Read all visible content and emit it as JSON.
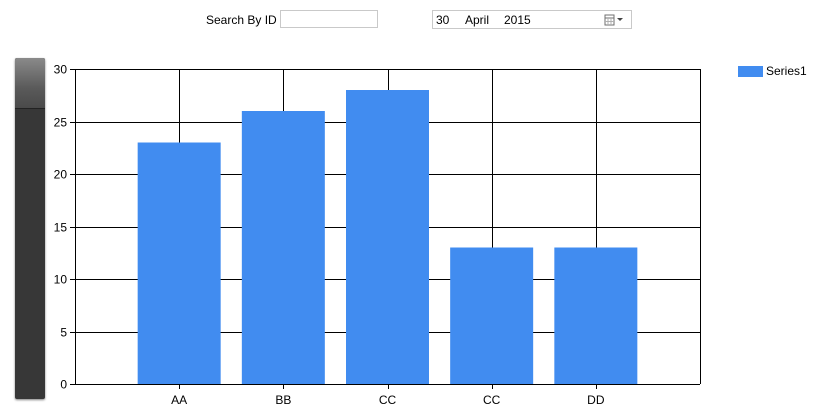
{
  "search": {
    "label": "Search By ID",
    "value": ""
  },
  "date_picker": {
    "day": "30",
    "month": "April",
    "year": "2015",
    "icon": "calendar-dropdown-icon"
  },
  "colors": {
    "bar": "#418cf0",
    "grid": "#000000",
    "scroll_track": "#373737"
  },
  "chart_data": {
    "type": "bar",
    "categories": [
      "AA",
      "BB",
      "CC",
      "CC",
      "DD"
    ],
    "series": [
      {
        "name": "Series1",
        "values": [
          23,
          26,
          28,
          13,
          13
        ]
      }
    ],
    "ylim": [
      0,
      30
    ],
    "yticks": [
      "0",
      "5",
      "10",
      "15",
      "20",
      "25",
      "30"
    ],
    "grid": true,
    "legend": "top-right",
    "title": "",
    "xlabel": "",
    "ylabel": ""
  }
}
